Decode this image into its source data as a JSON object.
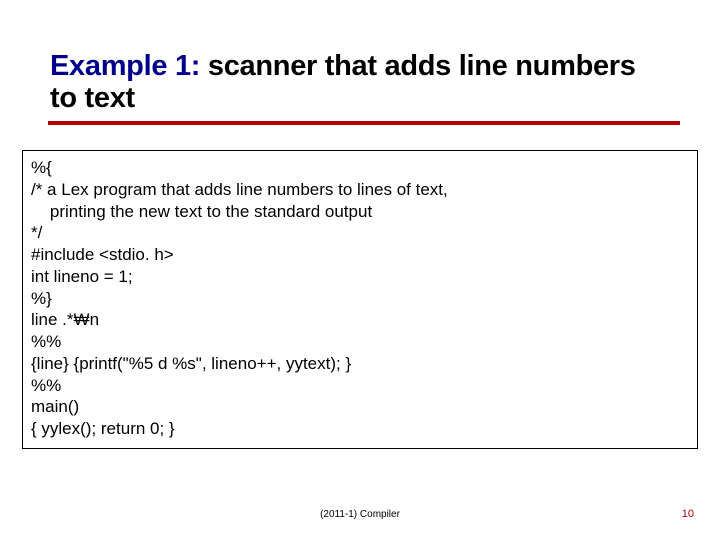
{
  "title": {
    "prefix": "Example 1:",
    "rest": " scanner that\nadds line numbers to text"
  },
  "code": [
    "%{",
    "/* a Lex program that adds line numbers to lines of text,",
    "    printing the new text to the standard output",
    "*/",
    "#include <stdio. h>",
    "int lineno = 1;",
    "%}",
    "line .*₩n",
    "%%",
    "{line} {printf(\"%5 d %s\", lineno++, yytext); }",
    "%%",
    "main()",
    "{ yylex(); return 0; }"
  ],
  "footer": {
    "center": "(2011-1) Compiler",
    "pageno": "10"
  }
}
